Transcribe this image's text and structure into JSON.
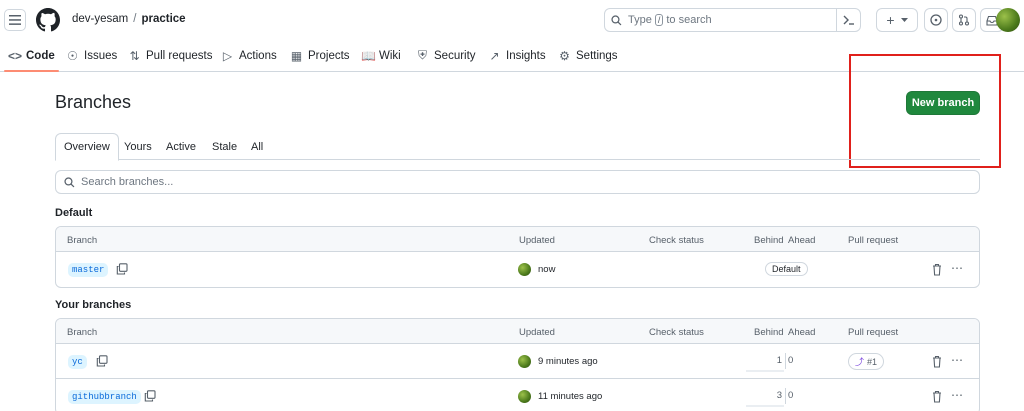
{
  "header": {
    "owner": "dev-yesam",
    "separator": "/",
    "repo": "practice",
    "search": {
      "type_label": "Type",
      "kbd": "/",
      "to_search": "to search"
    },
    "plus_label": "+"
  },
  "repo_tabs": [
    {
      "label": "Code",
      "icon": "code-icon"
    },
    {
      "label": "Issues",
      "icon": "issue-icon"
    },
    {
      "label": "Pull requests",
      "icon": "pull-request-icon"
    },
    {
      "label": "Actions",
      "icon": "play-icon"
    },
    {
      "label": "Projects",
      "icon": "table-icon"
    },
    {
      "label": "Wiki",
      "icon": "book-icon"
    },
    {
      "label": "Security",
      "icon": "shield-icon"
    },
    {
      "label": "Insights",
      "icon": "graph-icon"
    },
    {
      "label": "Settings",
      "icon": "gear-icon"
    }
  ],
  "page": {
    "title": "Branches",
    "new_branch_label": "New branch",
    "subtabs": [
      "Overview",
      "Yours",
      "Active",
      "Stale",
      "All"
    ],
    "search_placeholder": "Search branches..."
  },
  "columns": {
    "branch": "Branch",
    "updated": "Updated",
    "check_status": "Check status",
    "behind": "Behind",
    "ahead": "Ahead",
    "pull_request": "Pull request"
  },
  "default_section": {
    "heading": "Default",
    "rows": [
      {
        "name": "master",
        "updated": "now",
        "badge": "Default"
      }
    ]
  },
  "your_section": {
    "heading": "Your branches",
    "rows": [
      {
        "name": "yc",
        "updated": "9 minutes ago",
        "behind": "1",
        "ahead": "0",
        "pr": "#1"
      },
      {
        "name": "githubbranch",
        "updated": "11 minutes ago",
        "behind": "3",
        "ahead": "0"
      }
    ]
  },
  "colors": {
    "primary_button": "#1f883d",
    "active_tab_underline": "#fd8c73",
    "branch_text": "#0969da",
    "branch_bg": "#ddf4ff",
    "highlight_box": "#e0201b",
    "pr_icon": "#8250df"
  }
}
